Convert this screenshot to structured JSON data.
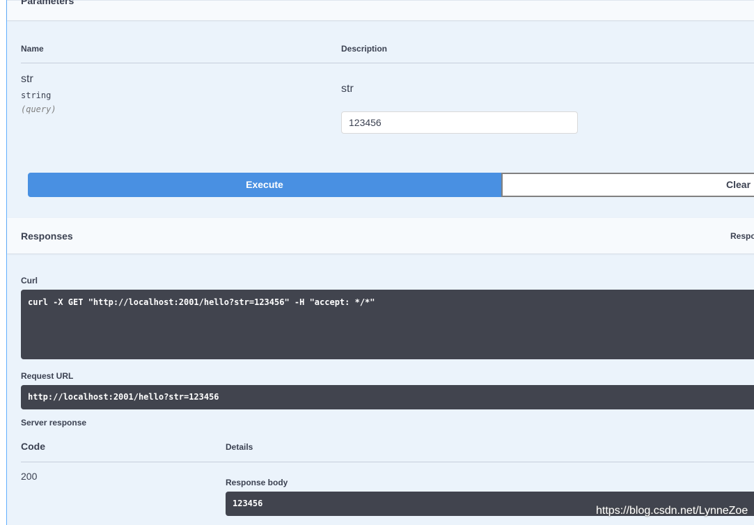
{
  "parameters": {
    "title": "Parameters",
    "columns": {
      "name": "Name",
      "description": "Description"
    },
    "items": [
      {
        "name": "str",
        "type": "string",
        "in": "(query)",
        "description": "str",
        "value": "123456"
      }
    ]
  },
  "actions": {
    "execute_label": "Execute",
    "clear_label": "Clear"
  },
  "responses": {
    "title": "Responses",
    "content_type_label": "Response content type",
    "curl_label": "Curl",
    "curl_command": "curl -X GET \"http://localhost:2001/hello?str=123456\" -H \"accept: */*\"",
    "request_url_label": "Request URL",
    "request_url": "http://localhost:2001/hello?str=123456",
    "server_response_label": "Server response",
    "columns": {
      "code": "Code",
      "details": "Details"
    },
    "code": "200",
    "body_label": "Response body",
    "body": "123456"
  },
  "watermark": "https://blog.csdn.net/LynneZoe",
  "colors": {
    "execute": "#4990e2",
    "code_bg": "#41444e",
    "panel_bg": "#ebf3fb",
    "accent": "#61affe"
  }
}
